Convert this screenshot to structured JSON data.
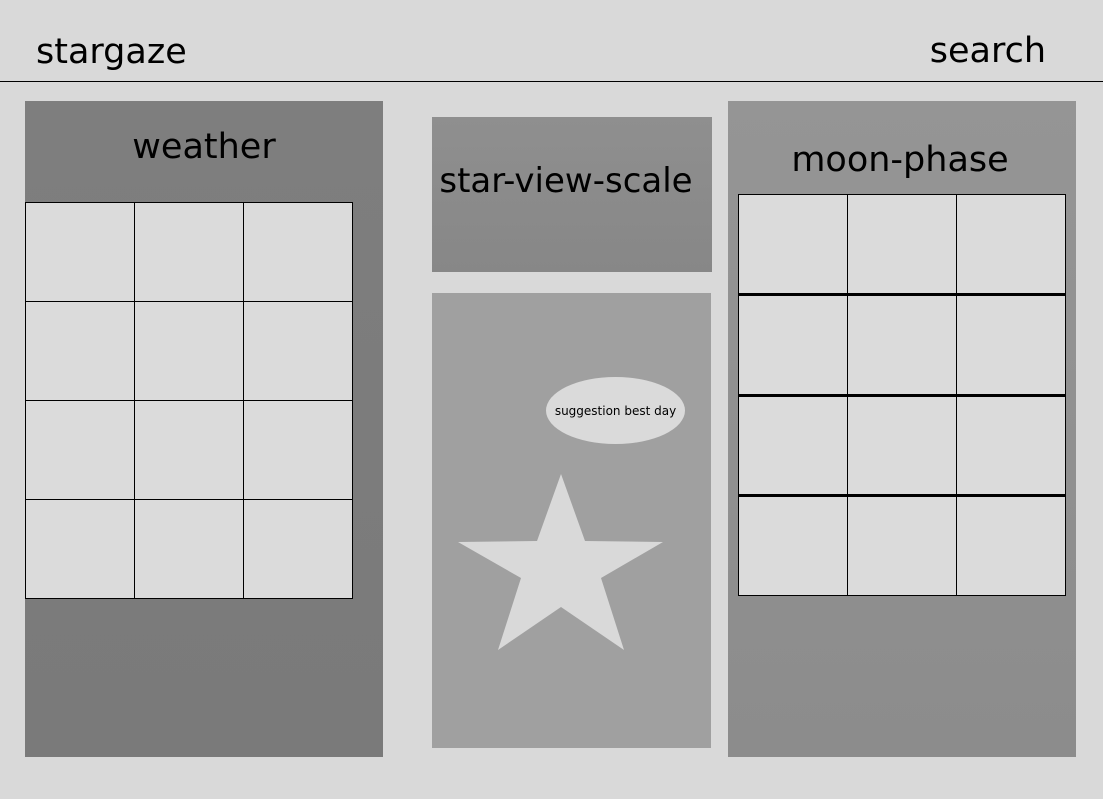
{
  "header": {
    "title": "stargaze",
    "search_label": "search"
  },
  "weather": {
    "title": "weather",
    "cells": [
      "",
      "",
      "",
      "",
      "",
      "",
      "",
      "",
      "",
      "",
      "",
      ""
    ]
  },
  "star_view_scale": {
    "title": "star-view-scale"
  },
  "suggestion": {
    "label": "suggestion best day"
  },
  "moon_phase": {
    "title": "moon-phase",
    "cells": [
      "",
      "",
      "",
      "",
      "",
      "",
      "",
      "",
      "",
      "",
      "",
      ""
    ]
  },
  "colors": {
    "background": "#d9d9d9",
    "weather_panel": "#7e7e7e",
    "moon_panel": "#929292",
    "scale_panel": "#8a8a8a",
    "suggestion_panel": "#a0a0a0",
    "cell": "#dbdbdb",
    "star": "#d9d9d9"
  },
  "icons": {
    "star": "star-icon"
  }
}
